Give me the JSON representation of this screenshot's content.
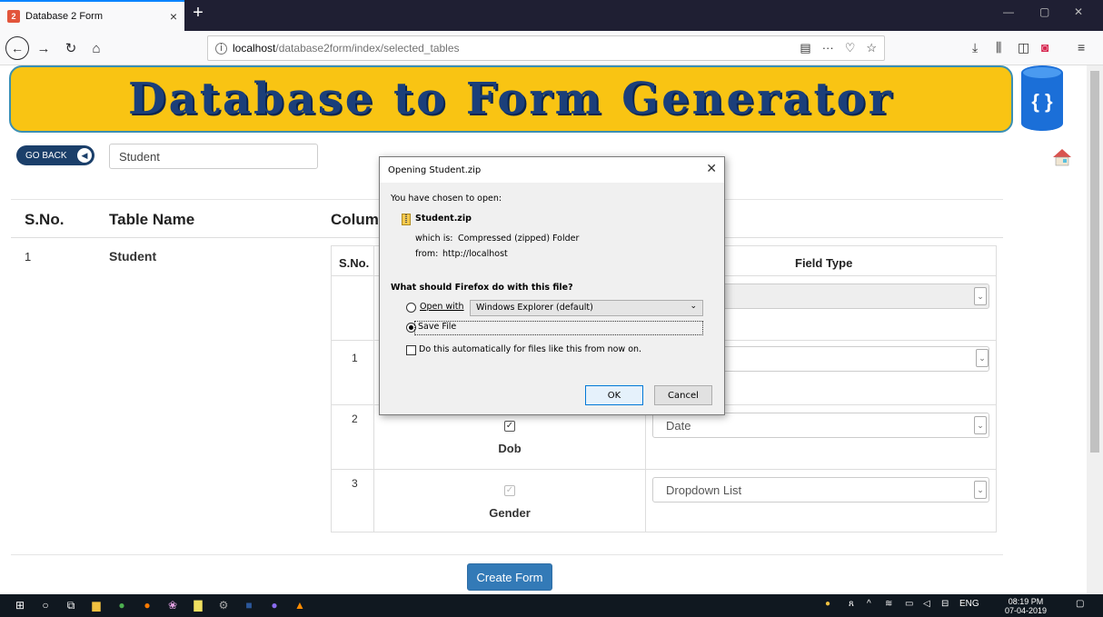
{
  "browser": {
    "tab_title": "Database 2 Form",
    "tab_close": "×",
    "new_tab": "+",
    "url_host": "localhost",
    "url_path": "/database2form/index/selected_tables",
    "win_min": "—",
    "win_restore": "▢",
    "win_close": "✕"
  },
  "page": {
    "banner_title": "Database to Form Generator",
    "db_logo": "{ }",
    "go_back": "GO BACK",
    "form_name": "Student",
    "headers": {
      "sno": "S.No.",
      "table_name": "Table Name",
      "columns": "Colum"
    },
    "rows": [
      {
        "sno": "1",
        "name": "Student"
      }
    ],
    "col_table": {
      "th_sno": "S.No.",
      "th_field_type": "Field Type",
      "rows": [
        {
          "sno": "1",
          "field_type": ""
        },
        {
          "sno": "2",
          "column": "Dob",
          "field_type": "Date"
        },
        {
          "sno": "3",
          "column": "Gender",
          "field_type": "Dropdown List"
        }
      ]
    },
    "create_form": "Create Form"
  },
  "dialog": {
    "title": "Opening Student.zip",
    "chosen": "You have chosen to open:",
    "file_name": "Student.zip",
    "which_is_label": "which is:",
    "which_is_value": "Compressed (zipped) Folder",
    "from_label": "from:",
    "from_value": "http://localhost",
    "question": "What should Firefox do with this file?",
    "open_with": "Open with",
    "open_with_app": "Windows Explorer (default)",
    "save_file": "Save File",
    "auto": "Do this automatically for files like this from now on.",
    "ok": "OK",
    "cancel": "Cancel"
  },
  "taskbar": {
    "time": "08:19 PM",
    "date": "07-04-2019",
    "lang": "ENG"
  },
  "colors": {
    "banner_bg": "#f9c413",
    "banner_text": "#1b3f7a",
    "primary_button": "#337ab7",
    "tab_accent": "#0a84ff"
  }
}
